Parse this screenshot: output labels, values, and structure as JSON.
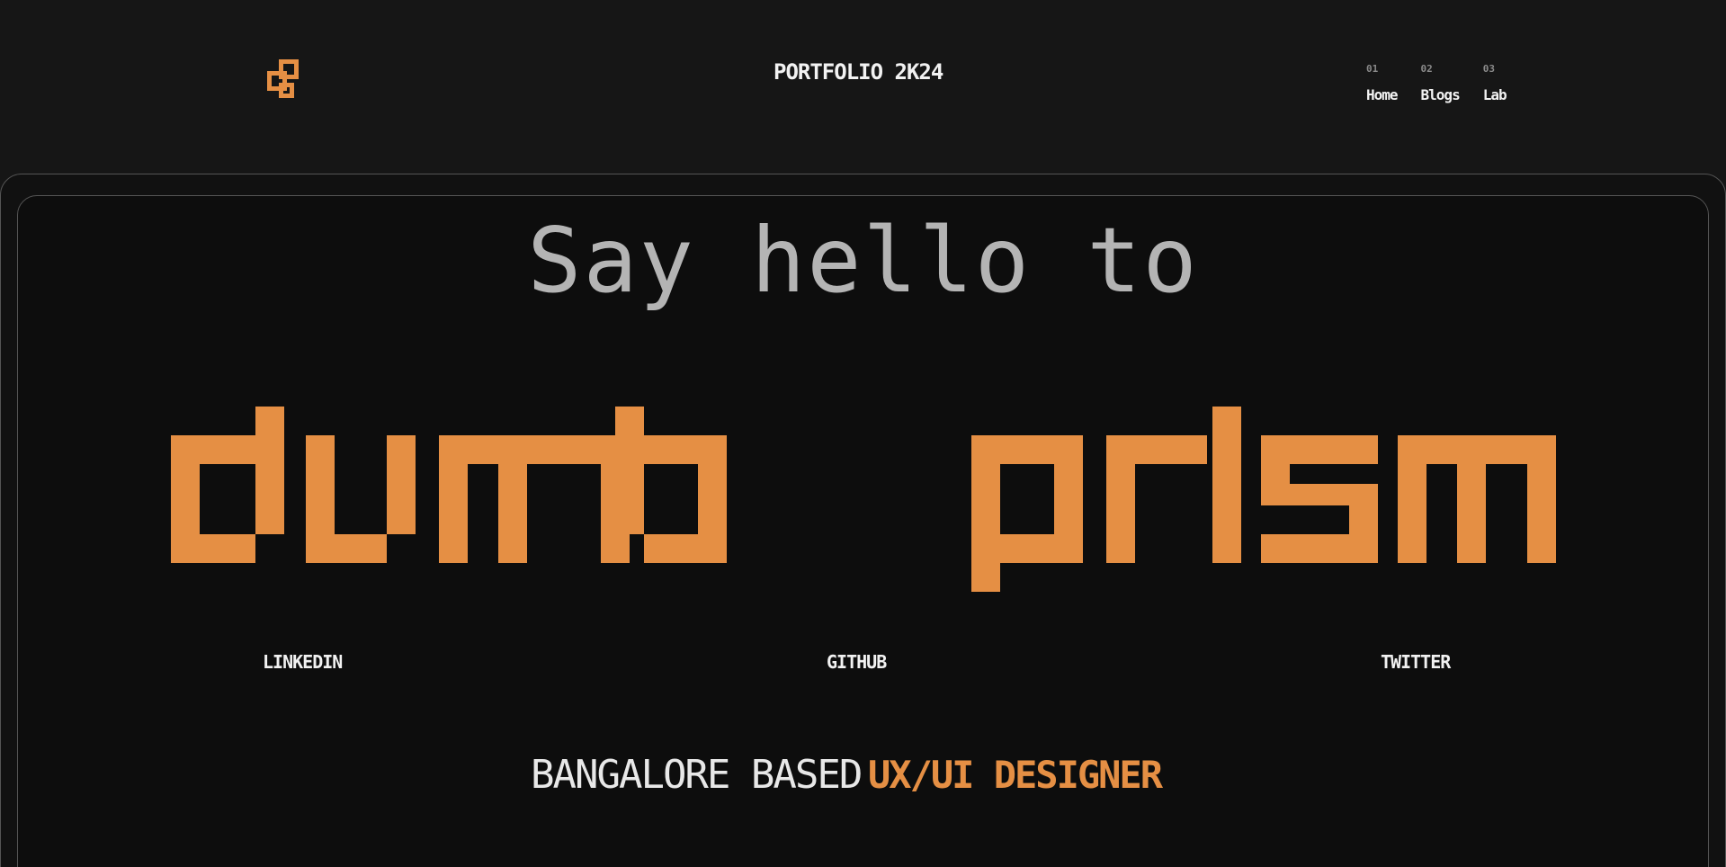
{
  "header": {
    "logo_icon": "pixel-logo-icon",
    "title": "PORTFOLIO 2K24"
  },
  "nav": {
    "items": [
      {
        "num": "01",
        "label": "Home"
      },
      {
        "num": "02",
        "label": "Blogs"
      },
      {
        "num": "03",
        "label": "Lab"
      }
    ]
  },
  "hero": {
    "greeting": "Say hello to",
    "name_word_1": "dumb",
    "name_word_2": "prism"
  },
  "social": {
    "linkedin": "LINKEDIN",
    "github": "GITHUB",
    "twitter": "TWITTER"
  },
  "tagline": {
    "base": "BANGALORE BASED",
    "role": "UX/UI DESIGNER"
  },
  "colors": {
    "accent": "#e58f44",
    "background": "#161616",
    "card": "#0d0d0d"
  }
}
